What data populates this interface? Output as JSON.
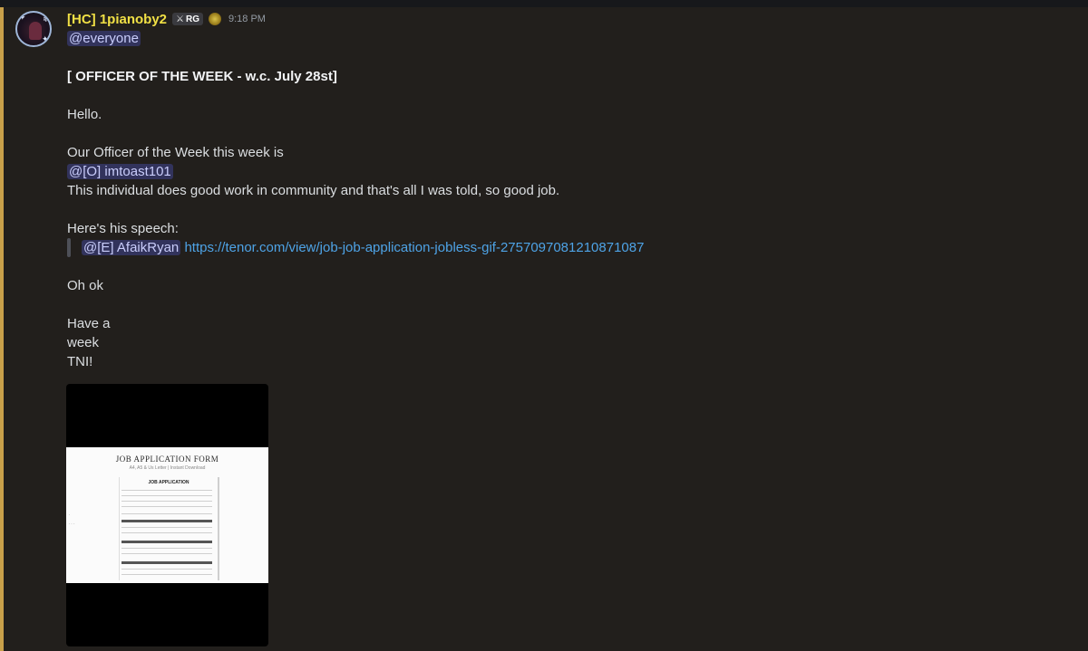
{
  "message": {
    "author": "[HC] 1pianoby2",
    "role_badge": "RG",
    "timestamp": "9:18 PM",
    "lines": {
      "mention_everyone": "@everyone",
      "heading": "[ OFFICER OF THE WEEK - w.c. July 28st]",
      "greeting": "Hello.",
      "intro": "Our Officer of the Week this week is",
      "officer_mention": "@[O] imtoast101",
      "praise": "This individual does good work in community and that's all I was told, so good job.",
      "speech_intro": "Here's his speech:",
      "quote_mention": "@[E] AfaikRyan",
      "quote_link": "https://tenor.com/view/job-job-application-jobless-gif-2757097081210871087",
      "reply": "Oh ok",
      "signoff_1": "Have a",
      "signoff_2": "week",
      "signoff_3": "TNI!"
    }
  },
  "embed": {
    "doc_title": "JOB APPLICATION FORM",
    "doc_subtitle": "A4, A5 & Us Letter | Instant Download",
    "form_title": "JOB APPLICATION"
  },
  "colors": {
    "background": "#221f1c",
    "username": "#f1e045",
    "mention_bg": "#5865f24d",
    "link": "#4ea3e6",
    "highlight_bar": "#c8a04a"
  },
  "icons": {
    "badge": "sword-icon",
    "clan": "emblem-icon"
  }
}
